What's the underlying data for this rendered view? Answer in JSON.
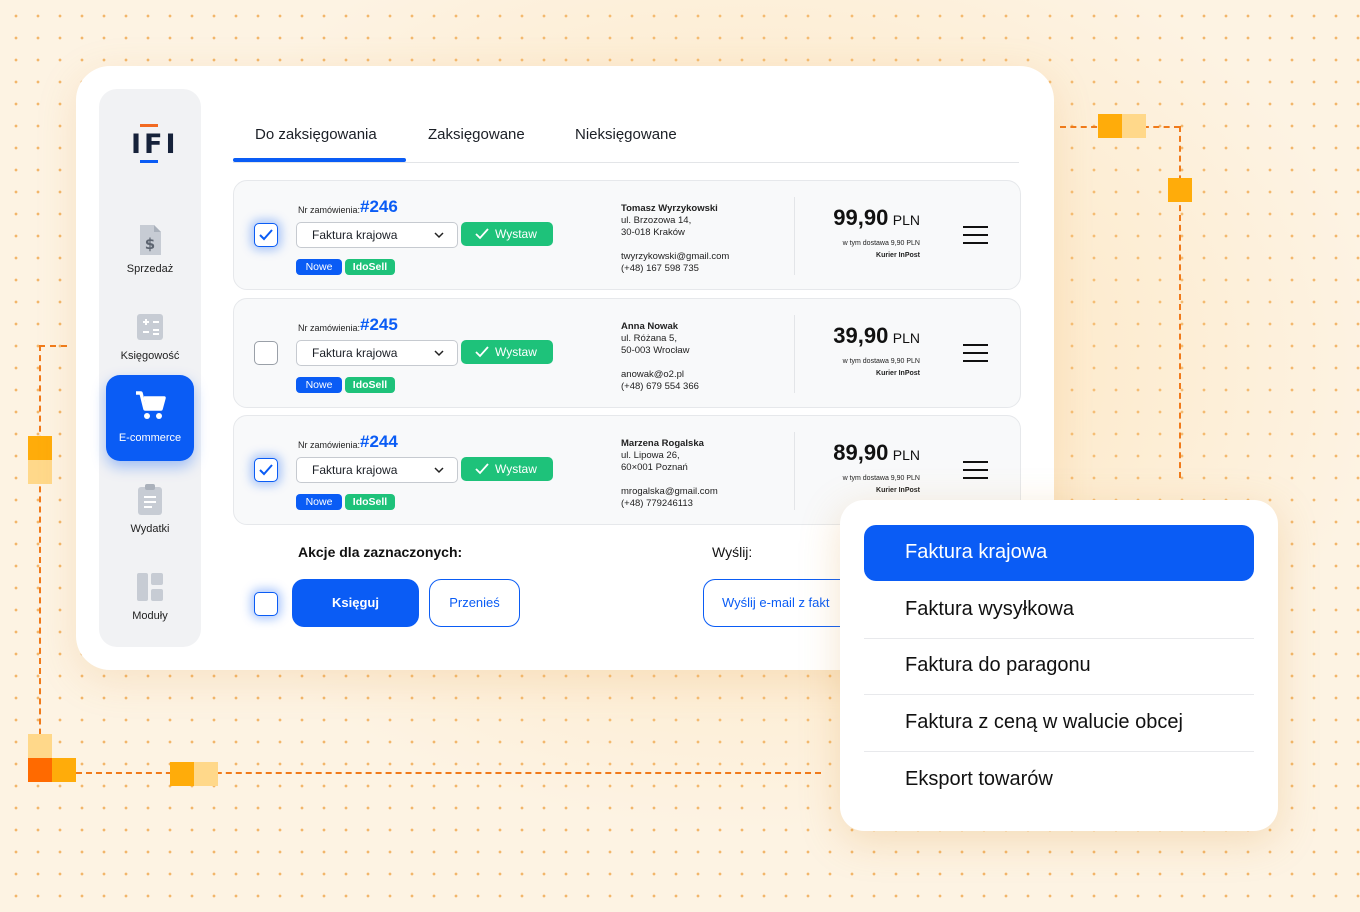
{
  "app": {
    "logo_text": "IFI"
  },
  "sidebar": {
    "items": [
      {
        "label": "Sprzedaż",
        "icon": "invoice-dollar-icon"
      },
      {
        "label": "Księgowość",
        "icon": "calculator-icon"
      },
      {
        "label": "E-commerce",
        "icon": "cart-icon",
        "active": true
      },
      {
        "label": "Wydatki",
        "icon": "clipboard-icon"
      },
      {
        "label": "Moduły",
        "icon": "modules-icon"
      }
    ]
  },
  "tabs": [
    {
      "label": "Do zaksięgowania",
      "active": true
    },
    {
      "label": "Zaksięgowane"
    },
    {
      "label": "Nieksięgowane"
    }
  ],
  "orders": [
    {
      "checked": true,
      "nr_label": "Nr zamówienia:",
      "nr": "#246",
      "invoice_type": "Faktura krajowa",
      "issue_label": "Wystaw",
      "badges": [
        "Nowe",
        "IdoSell"
      ],
      "customer": {
        "name": "Tomasz Wyrzykowski",
        "street": "ul. Brzozowa 14,",
        "city": "30-018 Kraków",
        "email": "twyrzykowski@gmail.com",
        "phone": "(+48) 167 598 735"
      },
      "price": "99,90",
      "currency": "PLN",
      "shipping_note": "w tym dostawa 9,90 PLN",
      "courier": "Kurier InPost"
    },
    {
      "checked": false,
      "nr_label": "Nr zamówienia:",
      "nr": "#245",
      "invoice_type": "Faktura krajowa",
      "issue_label": "Wystaw",
      "badges": [
        "Nowe",
        "IdoSell"
      ],
      "customer": {
        "name": "Anna Nowak",
        "street": "ul. Różana 5,",
        "city": "50-003 Wrocław",
        "email": "anowak@o2.pl",
        "phone": "(+48) 679 554 366"
      },
      "price": "39,90",
      "currency": "PLN",
      "shipping_note": "w tym dostawa 9,90 PLN",
      "courier": "Kurier InPost"
    },
    {
      "checked": true,
      "nr_label": "Nr zamówienia:",
      "nr": "#244",
      "invoice_type": "Faktura krajowa",
      "issue_label": "Wystaw",
      "badges": [
        "Nowe",
        "IdoSell"
      ],
      "customer": {
        "name": "Marzena Rogalska",
        "street": "ul. Lipowa 26,",
        "city": "60×001 Poznań",
        "email": "mrogalska@gmail.com",
        "phone": "(+48) 779246113"
      },
      "price": "89,90",
      "currency": "PLN",
      "shipping_note": "w tym dostawa 9,90 PLN",
      "courier": "Kurier InPost"
    }
  ],
  "bulk": {
    "actions_label": "Akcje dla zaznaczonych:",
    "send_label": "Wyślij:",
    "book_button": "Księguj",
    "move_button": "Przenieś",
    "email_button": "Wyślij e-mail z fakt"
  },
  "dropdown": {
    "options": [
      {
        "label": "Faktura krajowa",
        "selected": true
      },
      {
        "label": "Faktura wysyłkowa"
      },
      {
        "label": "Faktura do paragonu"
      },
      {
        "label": "Faktura z ceną w walucie obcej"
      },
      {
        "label": "Eksport towarów"
      }
    ]
  },
  "colors": {
    "accent": "#0a5cf5",
    "success": "#1ec27a",
    "decor": "#f07a1a"
  }
}
